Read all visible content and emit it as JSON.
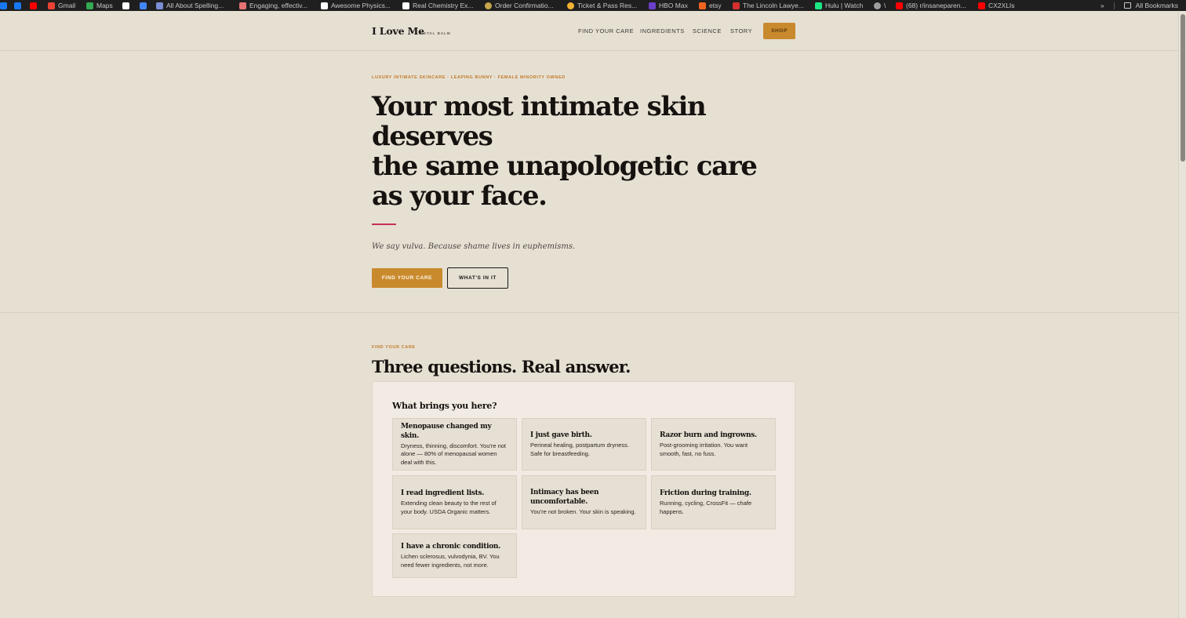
{
  "bookmarks": [
    {
      "label": "Gmail",
      "color": "#ea4335"
    },
    {
      "label": "Maps",
      "color": "#34a853"
    },
    {
      "label": "",
      "color": "#ffffff"
    },
    {
      "label": "",
      "color": "#4285f4"
    },
    {
      "label": "All About Spelling...",
      "color": "#7b8fd6"
    },
    {
      "label": "Engaging, effectiv...",
      "color": "#e57373"
    },
    {
      "label": "Awesome Physics...",
      "color": "#ffffff"
    },
    {
      "label": "Real Chemistry Ex...",
      "color": "#ffffff"
    },
    {
      "label": "Order Confirmatio...",
      "color": "#c9a64d"
    },
    {
      "label": "Ticket & Pass Res...",
      "color": "#f2b233"
    },
    {
      "label": "HBO Max",
      "color": "#6b3fc9"
    },
    {
      "label": "etsy",
      "color": "#f1641e"
    },
    {
      "label": "The Lincoln Lawye...",
      "color": "#d32f2f"
    },
    {
      "label": "Hulu | Watch",
      "color": "#1ce783"
    },
    {
      "label": "\\",
      "color": "#9e9e9e"
    },
    {
      "label": "(68) r/insaneparen...",
      "color": "#ff0000"
    },
    {
      "label": "CX2XLIs",
      "color": "#ff0000"
    }
  ],
  "bookmarks_right": {
    "chevron": "»",
    "all_label": "All Bookmarks"
  },
  "header": {
    "logo": "I Love Me",
    "logo_sub": "PETAL BALM",
    "nav": [
      "FIND YOUR CARE",
      "INGREDIENTS",
      "SCIENCE",
      "STORY"
    ],
    "shop": "SHOP"
  },
  "hero": {
    "eyebrow": "LUXURY INTIMATE SKINCARE · LEAPING BUNNY · FEMALE MINORITY OWNED",
    "title_lines": [
      "Your most intimate skin",
      "deserves",
      "the same unapologetic care",
      "as your face."
    ],
    "tagline": "We say vulva. Because shame lives in euphemisms.",
    "primary_cta": "FIND YOUR CARE",
    "secondary_cta": "WHAT'S IN IT"
  },
  "quiz": {
    "eyebrow": "FIND YOUR CARE",
    "title": "Three questions. Real answer.",
    "question": "What brings you here?",
    "options": [
      {
        "title": "Menopause changed my skin.",
        "desc": "Dryness, thinning, discomfort. You're not alone — 80% of menopausal women deal with this."
      },
      {
        "title": "I just gave birth.",
        "desc": "Perineal healing, postpartum dryness. Safe for breastfeeding."
      },
      {
        "title": "Razor burn and ingrowns.",
        "desc": "Post-grooming irritation. You want smooth, fast, no fuss."
      },
      {
        "title": "I read ingredient lists.",
        "desc": "Extending clean beauty to the rest of your body. USDA Organic matters."
      },
      {
        "title": "Intimacy has been uncomfortable.",
        "desc": "You're not broken. Your skin is speaking."
      },
      {
        "title": "Friction during training.",
        "desc": "Running, cycling, CrossFit — chafe happens."
      },
      {
        "title": "I have a chronic condition.",
        "desc": "Lichen sclerosus, vulvodynia, BV. You need fewer ingredients, not more."
      }
    ]
  },
  "colors": {
    "accent": "#c98a2d",
    "line": "#c8315a",
    "background": "#e6e0d3"
  }
}
